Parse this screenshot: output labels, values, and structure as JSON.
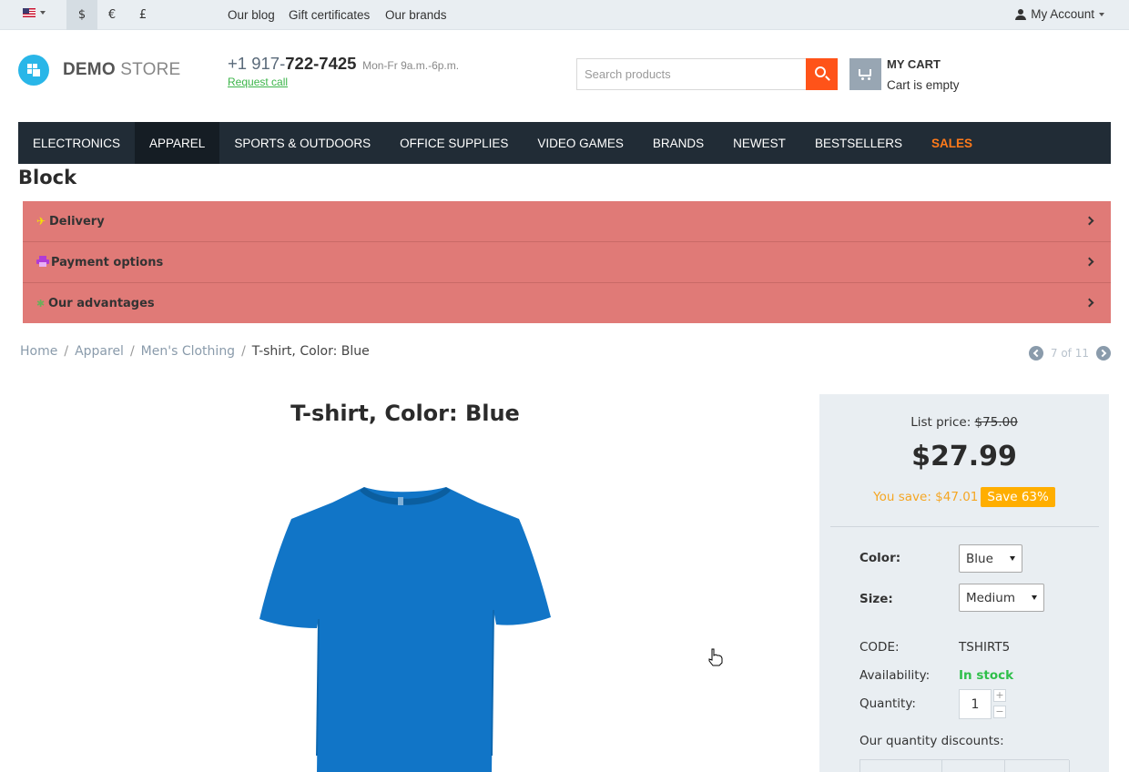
{
  "topbar": {
    "currencies": [
      "$",
      "€",
      "£"
    ],
    "links": [
      "Our blog",
      "Gift certificates",
      "Our brands"
    ],
    "account_label": "My Account"
  },
  "header": {
    "logo_bold": "DEMO",
    "logo_light": "STORE",
    "phone_prefix": "+1 917-",
    "phone_main": "722-7425",
    "phone_hours": "Mon-Fr 9a.m.-6p.m.",
    "request_call": "Request call",
    "search_placeholder": "Search products",
    "cart_title": "MY CART",
    "cart_status": "Cart is empty"
  },
  "nav": {
    "items": [
      "ELECTRONICS",
      "APPAREL",
      "SPORTS & OUTDOORS",
      "OFFICE SUPPLIES",
      "VIDEO GAMES",
      "BRANDS",
      "NEWEST",
      "BESTSELLERS",
      "SALES"
    ],
    "active": "APPAREL",
    "accent_color": "#ff7a1a"
  },
  "block": {
    "title": "Block",
    "rows": [
      {
        "label": "Delivery",
        "icon": "airplane-icon"
      },
      {
        "label": "Payment options",
        "icon": "printer-icon"
      },
      {
        "label": "Our advantages",
        "icon": "star-icon"
      }
    ]
  },
  "breadcrumb": {
    "items": [
      "Home",
      "Apparel",
      "Men's Clothing"
    ],
    "current": "T-shirt, Color: Blue",
    "pager": "7 of 11"
  },
  "product": {
    "title": "T-shirt, Color: Blue",
    "list_price_label": "List price:",
    "list_price": "$75.00",
    "price": "$27.99",
    "you_save": "You save: $47.01",
    "save_badge": "Save 63%",
    "color_label": "Color:",
    "color_value": "Blue",
    "size_label": "Size:",
    "size_value": "Medium",
    "code_label": "CODE:",
    "code_value": "TSHIRT5",
    "availability_label": "Availability:",
    "availability_value": "In stock",
    "quantity_label": "Quantity:",
    "quantity_value": "1",
    "discounts_label": "Our quantity discounts:"
  }
}
